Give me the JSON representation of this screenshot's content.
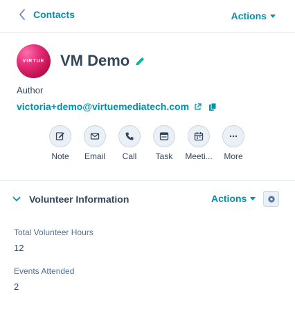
{
  "header": {
    "back_label": "Contacts",
    "actions_label": "Actions"
  },
  "contact": {
    "logo_text": "VIRTUE",
    "name": "VM Demo",
    "role": "Author",
    "email": "victoria+demo@virtuemediatech.com"
  },
  "quick_actions": [
    {
      "label": "Note",
      "icon": "pencil-note-icon"
    },
    {
      "label": "Email",
      "icon": "envelope-icon"
    },
    {
      "label": "Call",
      "icon": "phone-icon"
    },
    {
      "label": "Task",
      "icon": "task-icon"
    },
    {
      "label": "Meeti...",
      "icon": "calendar-icon"
    },
    {
      "label": "More",
      "icon": "ellipsis-icon"
    }
  ],
  "section": {
    "title": "Volunteer Information",
    "actions_label": "Actions",
    "fields": [
      {
        "label": "Total Volunteer Hours",
        "value": "12"
      },
      {
        "label": "Events Attended",
        "value": "2"
      }
    ]
  },
  "colors": {
    "accent": "#0091ae",
    "text": "#33475b",
    "muted": "#516f90",
    "icon_bg": "#eaf0f6",
    "border": "#cbd6e2",
    "logo": "#e6307a"
  }
}
